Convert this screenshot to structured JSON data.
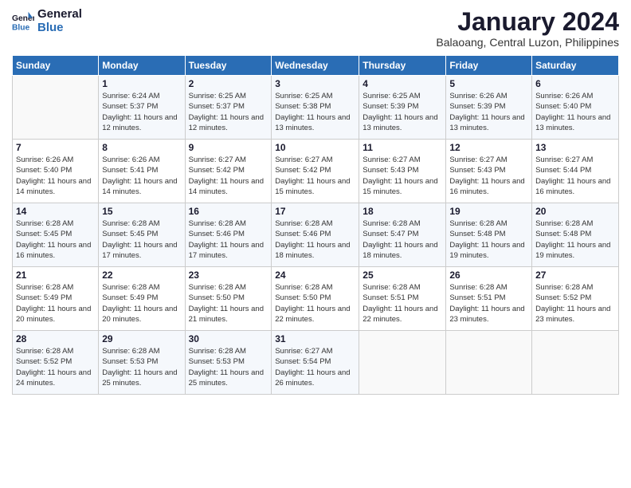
{
  "logo": {
    "text_general": "General",
    "text_blue": "Blue"
  },
  "header": {
    "month_year": "January 2024",
    "location": "Balaoang, Central Luzon, Philippines"
  },
  "weekdays": [
    "Sunday",
    "Monday",
    "Tuesday",
    "Wednesday",
    "Thursday",
    "Friday",
    "Saturday"
  ],
  "weeks": [
    [
      {
        "day": "",
        "sunrise": "",
        "sunset": "",
        "daylight": ""
      },
      {
        "day": "1",
        "sunrise": "Sunrise: 6:24 AM",
        "sunset": "Sunset: 5:37 PM",
        "daylight": "Daylight: 11 hours and 12 minutes."
      },
      {
        "day": "2",
        "sunrise": "Sunrise: 6:25 AM",
        "sunset": "Sunset: 5:37 PM",
        "daylight": "Daylight: 11 hours and 12 minutes."
      },
      {
        "day": "3",
        "sunrise": "Sunrise: 6:25 AM",
        "sunset": "Sunset: 5:38 PM",
        "daylight": "Daylight: 11 hours and 13 minutes."
      },
      {
        "day": "4",
        "sunrise": "Sunrise: 6:25 AM",
        "sunset": "Sunset: 5:39 PM",
        "daylight": "Daylight: 11 hours and 13 minutes."
      },
      {
        "day": "5",
        "sunrise": "Sunrise: 6:26 AM",
        "sunset": "Sunset: 5:39 PM",
        "daylight": "Daylight: 11 hours and 13 minutes."
      },
      {
        "day": "6",
        "sunrise": "Sunrise: 6:26 AM",
        "sunset": "Sunset: 5:40 PM",
        "daylight": "Daylight: 11 hours and 13 minutes."
      }
    ],
    [
      {
        "day": "7",
        "sunrise": "Sunrise: 6:26 AM",
        "sunset": "Sunset: 5:40 PM",
        "daylight": "Daylight: 11 hours and 14 minutes."
      },
      {
        "day": "8",
        "sunrise": "Sunrise: 6:26 AM",
        "sunset": "Sunset: 5:41 PM",
        "daylight": "Daylight: 11 hours and 14 minutes."
      },
      {
        "day": "9",
        "sunrise": "Sunrise: 6:27 AM",
        "sunset": "Sunset: 5:42 PM",
        "daylight": "Daylight: 11 hours and 14 minutes."
      },
      {
        "day": "10",
        "sunrise": "Sunrise: 6:27 AM",
        "sunset": "Sunset: 5:42 PM",
        "daylight": "Daylight: 11 hours and 15 minutes."
      },
      {
        "day": "11",
        "sunrise": "Sunrise: 6:27 AM",
        "sunset": "Sunset: 5:43 PM",
        "daylight": "Daylight: 11 hours and 15 minutes."
      },
      {
        "day": "12",
        "sunrise": "Sunrise: 6:27 AM",
        "sunset": "Sunset: 5:43 PM",
        "daylight": "Daylight: 11 hours and 16 minutes."
      },
      {
        "day": "13",
        "sunrise": "Sunrise: 6:27 AM",
        "sunset": "Sunset: 5:44 PM",
        "daylight": "Daylight: 11 hours and 16 minutes."
      }
    ],
    [
      {
        "day": "14",
        "sunrise": "Sunrise: 6:28 AM",
        "sunset": "Sunset: 5:45 PM",
        "daylight": "Daylight: 11 hours and 16 minutes."
      },
      {
        "day": "15",
        "sunrise": "Sunrise: 6:28 AM",
        "sunset": "Sunset: 5:45 PM",
        "daylight": "Daylight: 11 hours and 17 minutes."
      },
      {
        "day": "16",
        "sunrise": "Sunrise: 6:28 AM",
        "sunset": "Sunset: 5:46 PM",
        "daylight": "Daylight: 11 hours and 17 minutes."
      },
      {
        "day": "17",
        "sunrise": "Sunrise: 6:28 AM",
        "sunset": "Sunset: 5:46 PM",
        "daylight": "Daylight: 11 hours and 18 minutes."
      },
      {
        "day": "18",
        "sunrise": "Sunrise: 6:28 AM",
        "sunset": "Sunset: 5:47 PM",
        "daylight": "Daylight: 11 hours and 18 minutes."
      },
      {
        "day": "19",
        "sunrise": "Sunrise: 6:28 AM",
        "sunset": "Sunset: 5:48 PM",
        "daylight": "Daylight: 11 hours and 19 minutes."
      },
      {
        "day": "20",
        "sunrise": "Sunrise: 6:28 AM",
        "sunset": "Sunset: 5:48 PM",
        "daylight": "Daylight: 11 hours and 19 minutes."
      }
    ],
    [
      {
        "day": "21",
        "sunrise": "Sunrise: 6:28 AM",
        "sunset": "Sunset: 5:49 PM",
        "daylight": "Daylight: 11 hours and 20 minutes."
      },
      {
        "day": "22",
        "sunrise": "Sunrise: 6:28 AM",
        "sunset": "Sunset: 5:49 PM",
        "daylight": "Daylight: 11 hours and 20 minutes."
      },
      {
        "day": "23",
        "sunrise": "Sunrise: 6:28 AM",
        "sunset": "Sunset: 5:50 PM",
        "daylight": "Daylight: 11 hours and 21 minutes."
      },
      {
        "day": "24",
        "sunrise": "Sunrise: 6:28 AM",
        "sunset": "Sunset: 5:50 PM",
        "daylight": "Daylight: 11 hours and 22 minutes."
      },
      {
        "day": "25",
        "sunrise": "Sunrise: 6:28 AM",
        "sunset": "Sunset: 5:51 PM",
        "daylight": "Daylight: 11 hours and 22 minutes."
      },
      {
        "day": "26",
        "sunrise": "Sunrise: 6:28 AM",
        "sunset": "Sunset: 5:51 PM",
        "daylight": "Daylight: 11 hours and 23 minutes."
      },
      {
        "day": "27",
        "sunrise": "Sunrise: 6:28 AM",
        "sunset": "Sunset: 5:52 PM",
        "daylight": "Daylight: 11 hours and 23 minutes."
      }
    ],
    [
      {
        "day": "28",
        "sunrise": "Sunrise: 6:28 AM",
        "sunset": "Sunset: 5:52 PM",
        "daylight": "Daylight: 11 hours and 24 minutes."
      },
      {
        "day": "29",
        "sunrise": "Sunrise: 6:28 AM",
        "sunset": "Sunset: 5:53 PM",
        "daylight": "Daylight: 11 hours and 25 minutes."
      },
      {
        "day": "30",
        "sunrise": "Sunrise: 6:28 AM",
        "sunset": "Sunset: 5:53 PM",
        "daylight": "Daylight: 11 hours and 25 minutes."
      },
      {
        "day": "31",
        "sunrise": "Sunrise: 6:27 AM",
        "sunset": "Sunset: 5:54 PM",
        "daylight": "Daylight: 11 hours and 26 minutes."
      },
      {
        "day": "",
        "sunrise": "",
        "sunset": "",
        "daylight": ""
      },
      {
        "day": "",
        "sunrise": "",
        "sunset": "",
        "daylight": ""
      },
      {
        "day": "",
        "sunrise": "",
        "sunset": "",
        "daylight": ""
      }
    ]
  ]
}
